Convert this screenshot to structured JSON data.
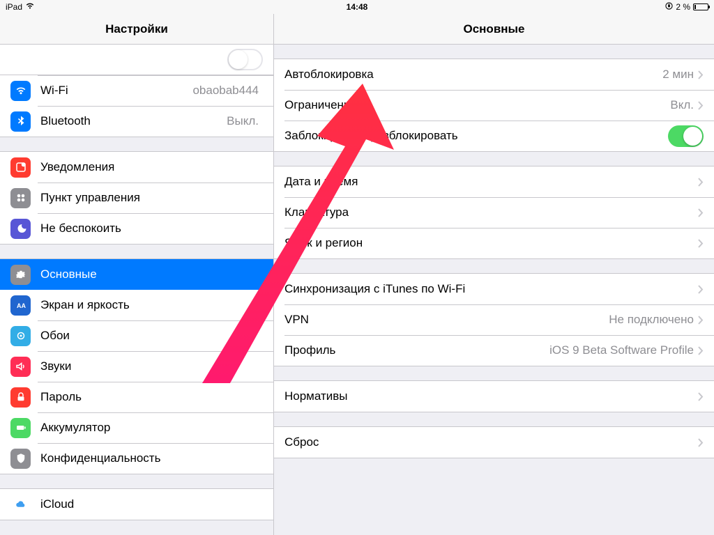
{
  "status": {
    "device": "iPad",
    "time": "14:48",
    "battery_pct": "2 %"
  },
  "sidebar": {
    "title": "Настройки",
    "items": {
      "airplane": {
        "label": ""
      },
      "wifi": {
        "label": "Wi-Fi",
        "value": "obaobab444"
      },
      "bluetooth": {
        "label": "Bluetooth",
        "value": "Выкл."
      },
      "notif": {
        "label": "Уведомления"
      },
      "control": {
        "label": "Пункт управления"
      },
      "dnd": {
        "label": "Не беспокоить"
      },
      "general": {
        "label": "Основные"
      },
      "display": {
        "label": "Экран и яркость"
      },
      "wallpaper": {
        "label": "Обои"
      },
      "sounds": {
        "label": "Звуки"
      },
      "passcode": {
        "label": "Пароль"
      },
      "battery": {
        "label": "Аккумулятор"
      },
      "privacy": {
        "label": "Конфиденциальность"
      },
      "icloud": {
        "label": "iCloud"
      }
    }
  },
  "main": {
    "title": "Основные",
    "rows": {
      "autolock": {
        "label": "Автоблокировка",
        "value": "2 мин"
      },
      "restrictions": {
        "label": "Ограничения",
        "value": "Вкл."
      },
      "lockunlock": {
        "label": "Заблокировать/разблокировать"
      },
      "datetime": {
        "label": "Дата и время"
      },
      "keyboard": {
        "label": "Клавиатура"
      },
      "language": {
        "label": "Язык и регион"
      },
      "itunes": {
        "label": "Синхронизация с iTunes по Wi-Fi"
      },
      "vpn": {
        "label": "VPN",
        "value": "Не подключено"
      },
      "profile": {
        "label": "Профиль",
        "value": "iOS 9 Beta Software Profile"
      },
      "regulatory": {
        "label": "Нормативы"
      },
      "reset": {
        "label": "Сброс"
      }
    }
  }
}
